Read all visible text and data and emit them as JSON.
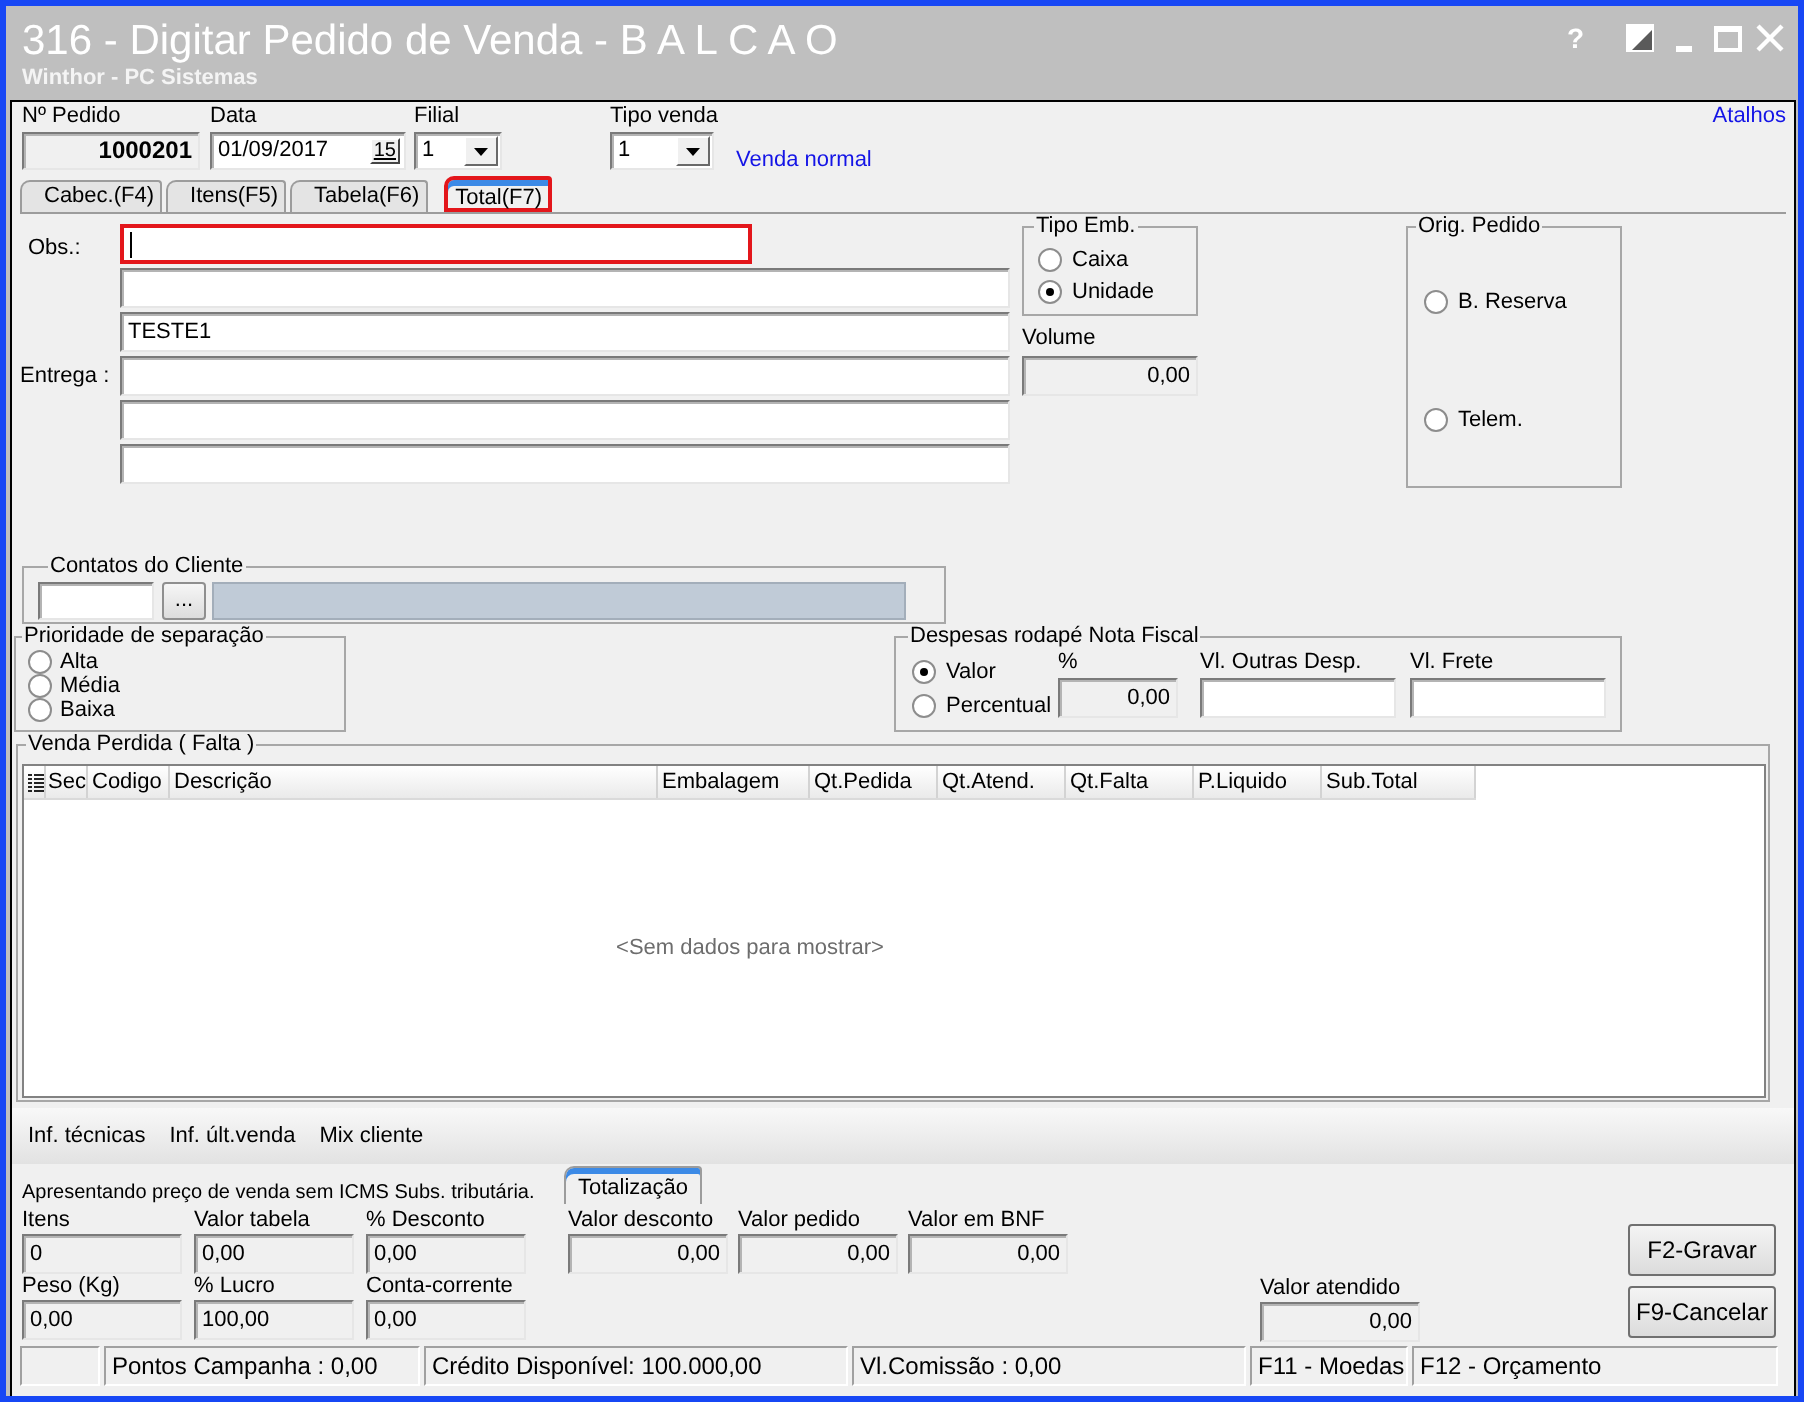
{
  "window": {
    "title": "316 - Digitar Pedido de Venda - B A L C A O",
    "subtitle": "Winthor - PC Sistemas",
    "help": "?"
  },
  "header": {
    "order_number": {
      "label": "Nº Pedido",
      "value": "1000201"
    },
    "date": {
      "label": "Data",
      "value": "01/09/2017",
      "calendar_day": "15"
    },
    "branch": {
      "label": "Filial",
      "value": "1"
    },
    "sale_type": {
      "label": "Tipo venda",
      "value": "1",
      "description": "Venda normal"
    },
    "shortcuts_link": "Atalhos"
  },
  "tabs": [
    {
      "label": "Cabec.(F4)",
      "selected": false,
      "highlighted": false
    },
    {
      "label": "Itens(F5)",
      "selected": false,
      "highlighted": false
    },
    {
      "label": "Tabela(F6)",
      "selected": false,
      "highlighted": false
    },
    {
      "label": "Total(F7)",
      "selected": true,
      "highlighted": true
    }
  ],
  "observations": {
    "label": "Obs.:",
    "fields": [
      {
        "focused": true,
        "highlighted": true
      },
      {
        "focused": false,
        "highlighted": false
      },
      {
        "value": "TESTE1",
        "focused": false,
        "highlighted": false
      }
    ]
  },
  "delivery": {
    "label": "Entrega :",
    "fields": [
      {
        "focused": false,
        "highlighted": false
      },
      {
        "focused": false,
        "highlighted": false
      },
      {
        "focused": false,
        "highlighted": false
      }
    ]
  },
  "packaging_type": {
    "title": "Tipo Emb.",
    "options": [
      {
        "label": "Caixa",
        "selected": false
      },
      {
        "label": "Unidade",
        "selected": true
      }
    ]
  },
  "volume": {
    "label": "Volume",
    "value": "0,00"
  },
  "order_origin": {
    "title": "Orig. Pedido",
    "options": [
      {
        "label": "B. Reserva",
        "selected": false
      },
      {
        "label": "Telem.",
        "selected": false
      }
    ]
  },
  "customer_contacts": {
    "title": "Contatos do Cliente",
    "lookup_button": "..."
  },
  "separation_priority": {
    "title": "Prioridade de separação",
    "options": [
      {
        "label": "Alta",
        "selected": false
      },
      {
        "label": "Média",
        "selected": false
      },
      {
        "label": "Baixa",
        "selected": false
      }
    ]
  },
  "invoice_expenses": {
    "title": "Despesas rodapé Nota Fiscal",
    "options": [
      {
        "label": "Valor",
        "selected": true
      },
      {
        "label": "Percentual",
        "selected": false
      }
    ],
    "fields": [
      {
        "label": "%",
        "value": "0,00",
        "readonly": true
      },
      {
        "label": "Vl. Outras Desp.",
        "readonly": false
      },
      {
        "label": "Vl. Frete",
        "readonly": false
      }
    ]
  },
  "lost_sales": {
    "title": "Venda Perdida ( Falta )",
    "columns": [
      "Sec",
      "Codigo",
      "Descrição",
      "Embalagem",
      "Qt.Pedida",
      "Qt.Atend.",
      "Qt.Falta",
      "P.Liquido",
      "Sub.Total"
    ],
    "empty_message": "<Sem dados para mostrar>"
  },
  "links": [
    "Inf. técnicas",
    "Inf. últ.venda",
    "Mix cliente"
  ],
  "footer": {
    "note": "Apresentando preço de venda sem ICMS Subs. tributária.",
    "tabs": [
      {
        "label": "Totalização",
        "selected": true
      }
    ],
    "summary": [
      {
        "label": "Itens",
        "value": "0"
      },
      {
        "label": "Valor tabela",
        "value": "0,00"
      },
      {
        "label": "% Desconto",
        "value": "0,00"
      },
      {
        "label": "Peso (Kg)",
        "value": "0,00"
      },
      {
        "label": "% Lucro",
        "value": "100,00"
      },
      {
        "label": "Conta-corrente",
        "value": "0,00"
      }
    ],
    "totals": [
      {
        "label": "Valor desconto",
        "value": "0,00"
      },
      {
        "label": "Valor pedido",
        "value": "0,00"
      },
      {
        "label": "Valor em BNF",
        "value": "0,00"
      }
    ],
    "attended": {
      "label": "Valor atendido",
      "value": "0,00"
    },
    "buttons": [
      "F2-Gravar",
      "F9-Cancelar"
    ]
  },
  "status_bar": [
    "Pontos Campanha : 0,00",
    "Crédito Disponível: 100.000,00",
    "Vl.Comissão : 0,00",
    "F11 - Moedas",
    "F12 - Orçamento"
  ]
}
